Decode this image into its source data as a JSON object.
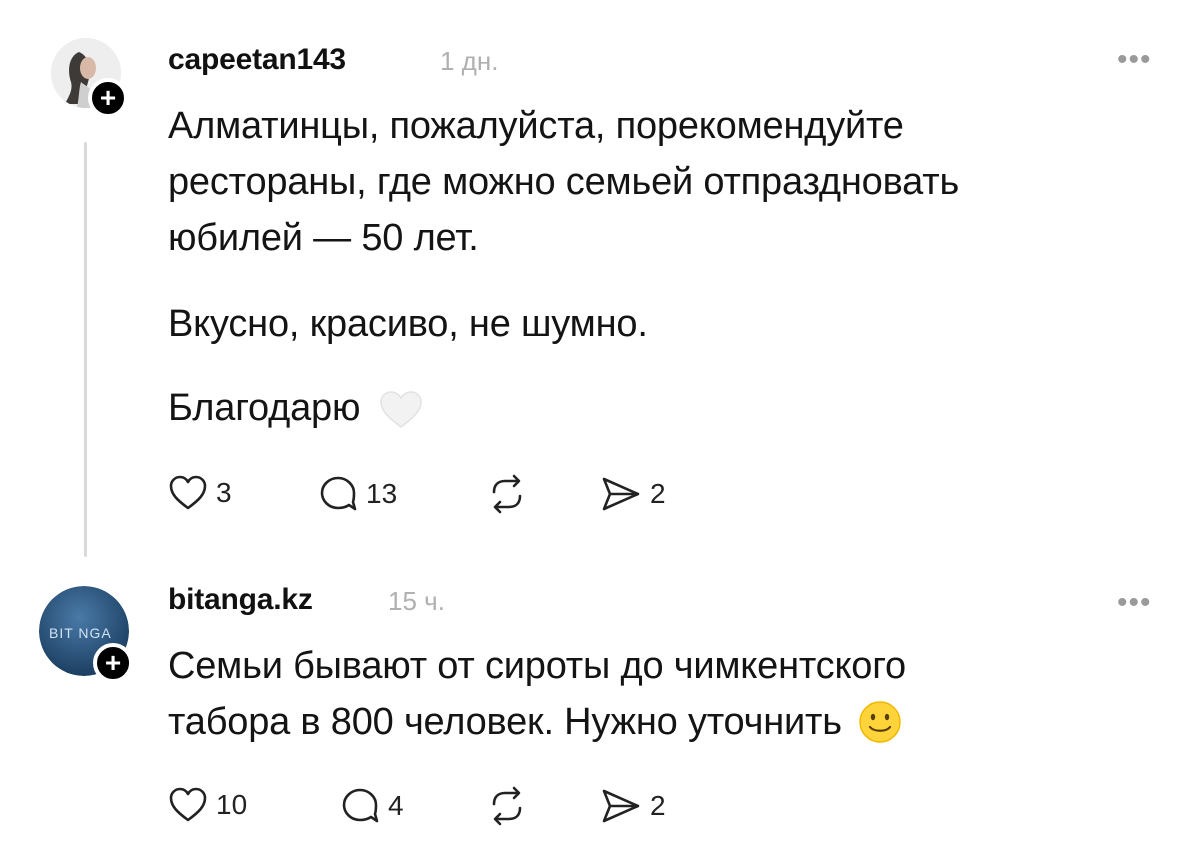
{
  "posts": [
    {
      "username": "capeetan143",
      "time": "1 дн.",
      "more": "•••",
      "paragraphs": [
        [
          "Алматинцы, пожалуйста, порекомендуйте",
          "рестораны, где можно семьей отпраздновать",
          "юбилей — 50 лет."
        ],
        [
          "Вкусно, красиво, не шумно."
        ],
        [
          "Благодарю"
        ]
      ],
      "emoji": "white-heart",
      "actions": {
        "likes": "3",
        "replies": "13",
        "reposts": "",
        "shares": "2"
      }
    },
    {
      "username": "bitanga.kz",
      "time": "15 ч.",
      "more": "•••",
      "avatar_text": "BIT NGA",
      "paragraphs": [
        [
          "Семьи бывают от сироты до чимкентского",
          "табора в 800 человек. Нужно уточнить"
        ]
      ],
      "emoji": "slightly-smiling-face",
      "actions": {
        "likes": "10",
        "replies": "4",
        "reposts": "",
        "shares": "2"
      }
    }
  ],
  "icons": {
    "like": "heart-outline-icon",
    "reply": "speech-bubble-icon",
    "repost": "repost-arrows-icon",
    "share": "paper-plane-icon",
    "follow": "plus-icon"
  },
  "colors": {
    "text": "#141414",
    "muted": "#b0b0b0",
    "thread_line": "#d9d9d9",
    "avatar2_bg": "#1f4a70"
  }
}
